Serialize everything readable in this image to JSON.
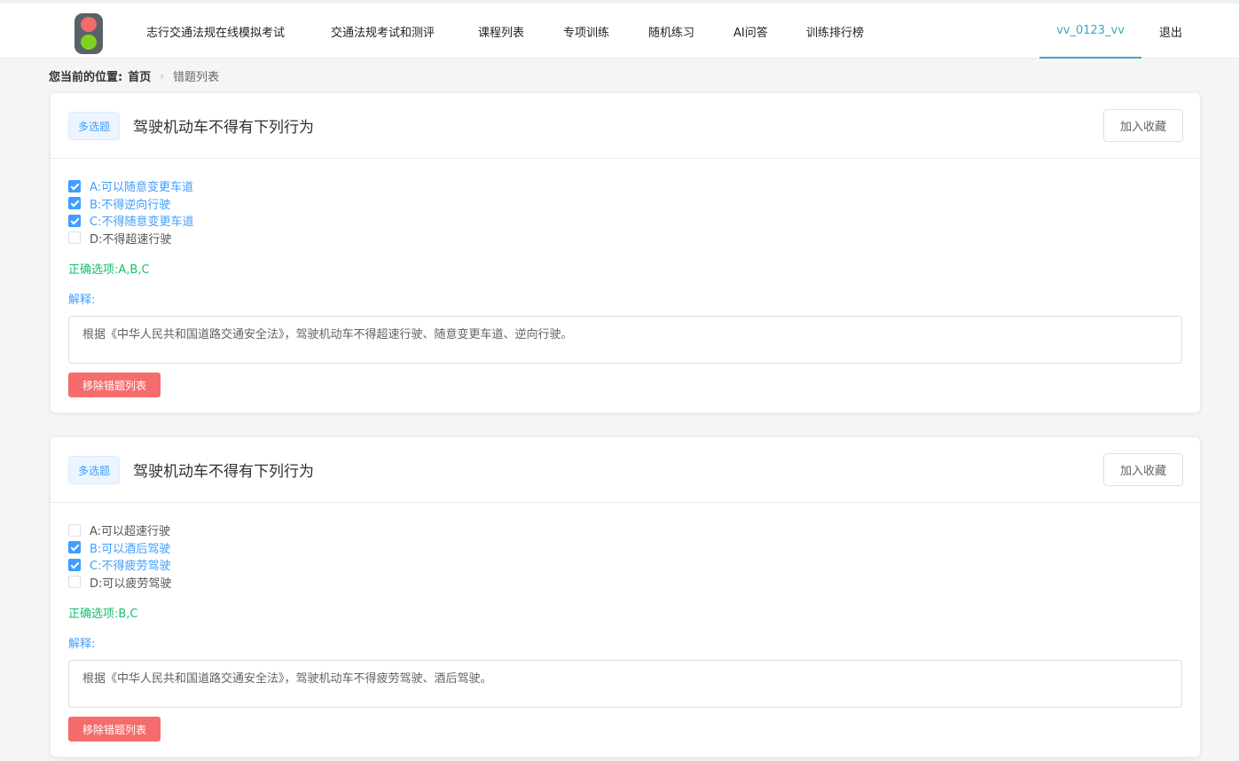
{
  "header": {
    "nav": [
      {
        "label": "志行交通法规在线模拟考试"
      },
      {
        "label": "交通法规考试和测评"
      },
      {
        "label": "课程列表"
      },
      {
        "label": "专项训练"
      },
      {
        "label": "随机练习"
      },
      {
        "label": "AI问答"
      },
      {
        "label": "训练排行榜"
      }
    ],
    "username": "vv_0123_vv",
    "logout": "退出"
  },
  "breadcrumb": {
    "label": "您当前的位置:",
    "home": "首页",
    "current": "错题列表"
  },
  "questions": [
    {
      "type": "多选题",
      "title": "驾驶机动车不得有下列行为",
      "favorite_label": "加入收藏",
      "options": [
        {
          "text": "A:可以随意变更车道",
          "checked": true
        },
        {
          "text": "B:不得逆向行驶",
          "checked": true
        },
        {
          "text": "C:不得随意变更车道",
          "checked": true
        },
        {
          "text": "D:不得超速行驶",
          "checked": false
        }
      ],
      "answer": "正确选项:A,B,C",
      "explain_label": "解释:",
      "explanation": "根据《中华人民共和国道路交通安全法》，驾驶机动车不得超速行驶、随意变更车道、逆向行驶。",
      "remove_label": "移除错题列表"
    },
    {
      "type": "多选题",
      "title": "驾驶机动车不得有下列行为",
      "favorite_label": "加入收藏",
      "options": [
        {
          "text": "A:可以超速行驶",
          "checked": false
        },
        {
          "text": "B:可以酒后驾驶",
          "checked": true
        },
        {
          "text": "C:不得疲劳驾驶",
          "checked": true
        },
        {
          "text": "D:可以疲劳驾驶",
          "checked": false
        }
      ],
      "answer": "正确选项:B,C",
      "explain_label": "解释:",
      "explanation": "根据《中华人民共和国道路交通安全法》，驾驶机动车不得疲劳驾驶、酒后驾驶。",
      "remove_label": "移除错题列表"
    }
  ],
  "colors": {
    "accent": "#3aa8c1",
    "primary": "#409eff",
    "success": "#19be6b",
    "danger": "#f56c6c"
  }
}
